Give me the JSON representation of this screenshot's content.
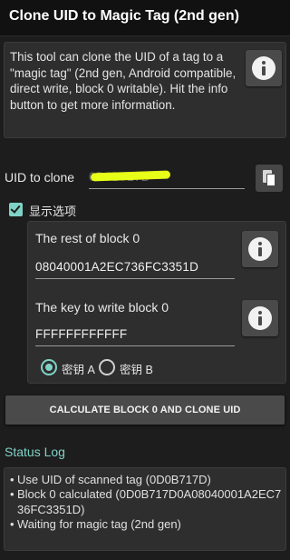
{
  "app": {
    "title": "Clone UID to Magic Tag (2nd gen)"
  },
  "info": {
    "description": "This tool can clone the UID of a tag to a \"magic tag\" (2nd gen, Android compatible, direct write, block 0 writable). Hit the info button to get more information.",
    "button_icon": "info-icon"
  },
  "uid": {
    "label": "UID to clone",
    "value": "0D0B717D",
    "paste_icon": "paste-icon"
  },
  "options": {
    "show_options_label": "显示选项",
    "show_options_checked": true,
    "rest_of_block_label": "The rest of block 0",
    "rest_of_block_value": "08040001A2EC736FC3351D",
    "key_label": "The key to write block 0",
    "key_value": "FFFFFFFFFFFF",
    "key_a_label": "密钥 A",
    "key_b_label": "密钥 B",
    "selected_key": "A"
  },
  "action": {
    "button_label": "CALCULATE BLOCK 0 AND CLONE UID"
  },
  "status": {
    "title": "Status Log",
    "entries": [
      "Use UID of scanned tag (0D0B717D)",
      "Block 0 calculated (0D0B717D0A08040001A2EC736FC3351D)",
      "Waiting for magic tag (2nd gen)"
    ]
  },
  "colors": {
    "accent": "#7fd3c6",
    "background": "#1d1d1d",
    "card": "#2e2e2e",
    "highlight": "#e8ff17"
  }
}
